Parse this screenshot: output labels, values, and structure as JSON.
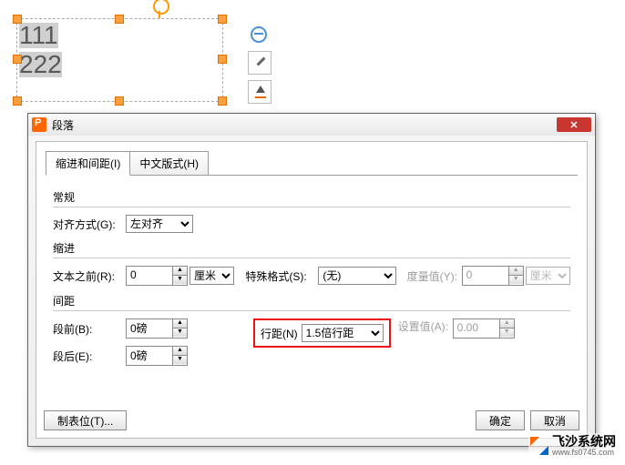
{
  "textbox": {
    "line1": "111",
    "line2": "222"
  },
  "dialog": {
    "title": "段落",
    "tabs": {
      "indent": "缩进和间距(I)",
      "chinese": "中文版式(H)"
    },
    "general": {
      "legend": "常规",
      "align_label": "对齐方式(G):",
      "align_value": "左对齐"
    },
    "indent": {
      "legend": "缩进",
      "before_label": "文本之前(R):",
      "before_value": "0",
      "before_unit": "厘米",
      "special_label": "特殊格式(S):",
      "special_value": "(无)",
      "measure_label": "度量值(Y):",
      "measure_value": "0",
      "measure_unit": "厘米"
    },
    "spacing": {
      "legend": "间距",
      "before_label": "段前(B):",
      "before_value": "0磅",
      "after_label": "段后(E):",
      "after_value": "0磅",
      "line_label": "行距(N)",
      "line_value": "1.5倍行距",
      "setat_label": "设置值(A):",
      "setat_value": "0.00"
    },
    "buttons": {
      "tabs": "制表位(T)...",
      "ok": "确定",
      "cancel": "取消"
    }
  },
  "watermark": {
    "name": "飞沙系统网",
    "url": "www.fs0745.com"
  }
}
